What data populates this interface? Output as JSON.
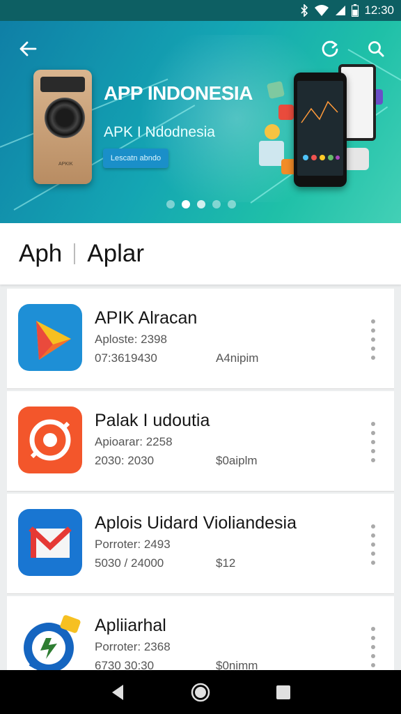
{
  "status_bar": {
    "time": "12:30",
    "icons": [
      "bluetooth-icon",
      "wifi-icon",
      "signal-icon",
      "battery-icon"
    ]
  },
  "banner": {
    "title": "APP INDONESIA",
    "subtitle": "APK I Ndodnesia",
    "button_label": "Lescatn abndo",
    "camera_brand": "APKIK",
    "carousel": {
      "count": 5,
      "active": 1
    }
  },
  "toolbar": {
    "back_icon": "back-arrow-icon",
    "refresh_icon": "refresh-icon",
    "search_icon": "search-icon"
  },
  "section": {
    "tab1": "Aph",
    "tab2": "Aplar"
  },
  "apps": [
    {
      "name": "APIK Alracan",
      "line1": "Aploste: 2398",
      "line2": "07:3619430",
      "line3": "A4nipim",
      "icon": "play-icon"
    },
    {
      "name": "Palak I udoutia",
      "line1": "Apioarar: 2258",
      "line2": "2030: 2030",
      "line3": "$0aiplm",
      "icon": "target-icon"
    },
    {
      "name": "Aplois Uidard Violiandesia",
      "line1": "Porroter: 2493",
      "line2": "5030 / 24000",
      "line3": "$12",
      "icon": "mail-icon"
    },
    {
      "name": "Apliiarhal",
      "line1": "Porroter: 2368",
      "line2": "6730 30:30",
      "line3": "$0nimm",
      "icon": "messenger-icon"
    }
  ],
  "colors": {
    "status_bar": "#0d5f63",
    "banner_start": "#0f7fa6",
    "banner_end": "#43d0b6",
    "card": "#ffffff",
    "background": "#eceeef"
  },
  "nav": {
    "icons": [
      "back-triangle-icon",
      "home-circle-icon",
      "recents-square-icon"
    ]
  }
}
